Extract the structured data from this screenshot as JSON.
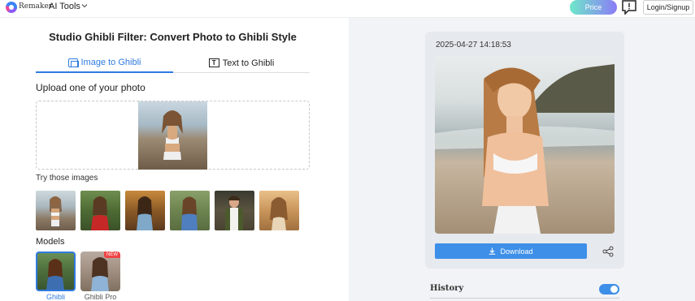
{
  "nav": {
    "brand": "Remaker",
    "menu_label": "AI Tools",
    "price_label": "Price",
    "login_label": "Login/Signup"
  },
  "main": {
    "title": "Studio Ghibli Filter: Convert Photo to Ghibli Style",
    "tabs": [
      {
        "label": "Image to Ghibli",
        "icon": "image-icon",
        "active": true
      },
      {
        "label": "Text to Ghibli",
        "icon": "text-icon",
        "active": false
      }
    ],
    "upload_label": "Upload one of your photo",
    "try_label": "Try those images",
    "models_label": "Models",
    "models": [
      {
        "name": "Ghibli",
        "selected": true
      },
      {
        "name": "Ghibli Pro",
        "selected": false,
        "badge": "NEW"
      }
    ]
  },
  "result": {
    "timestamp": "2025-04-27 14:18:53",
    "download_label": "Download"
  },
  "history": {
    "label": "History",
    "toggle_on": true
  },
  "colors": {
    "accent": "#2f7be0",
    "download": "#3d8fe8",
    "badge": "#ef4444"
  }
}
